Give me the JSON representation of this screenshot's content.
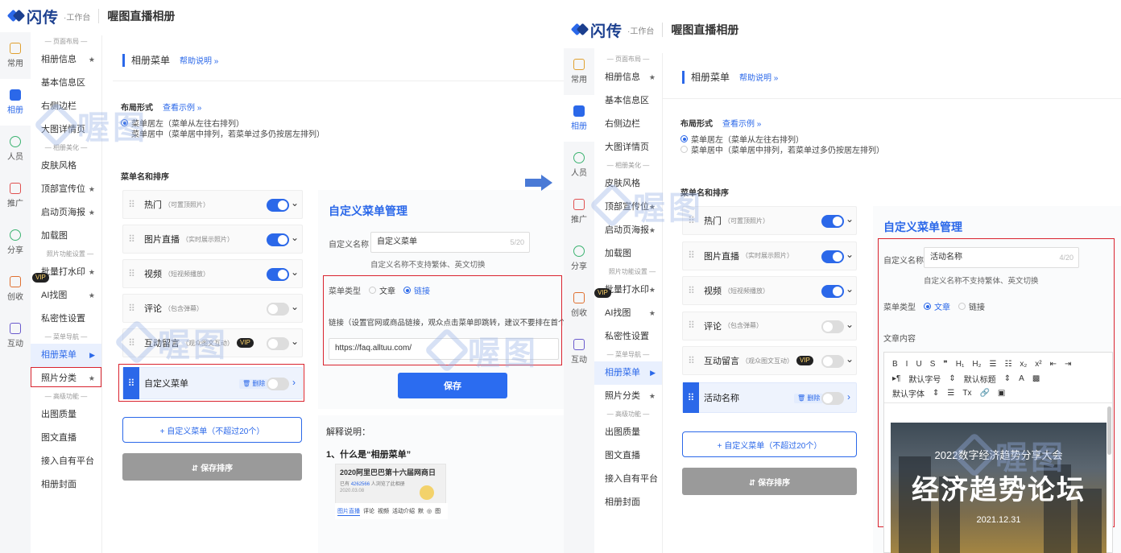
{
  "app": {
    "logo_name": "闪传",
    "logo_sub": "·工作台",
    "page_title": "喔图直播相册"
  },
  "rail": [
    {
      "label": "常用",
      "icon": "star-icon"
    },
    {
      "label": "相册",
      "icon": "album-icon"
    },
    {
      "label": "人员",
      "icon": "people-icon"
    },
    {
      "label": "推广",
      "icon": "promote-icon"
    },
    {
      "label": "分享",
      "icon": "share-icon"
    },
    {
      "label": "创收",
      "icon": "revenue-icon"
    },
    {
      "label": "互动",
      "icon": "interact-icon"
    }
  ],
  "sidebar": {
    "sec_layout": "— 页面布局 —",
    "album_info": "相册信息",
    "basic_info": "基本信息区",
    "right_bar": "右侧边栏",
    "big_detail": "大图详情页",
    "sec_beauty": "— 相册美化 —",
    "skin": "皮肤风格",
    "top_promo": "顶部宣传位",
    "splash": "启动页海报",
    "loading": "加载图",
    "sec_photo": "照片功能设置 —",
    "vip": "VIP",
    "watermark": "批量打水印",
    "ai_find": "AI找图",
    "privacy": "私密性设置",
    "sec_nav": "— 菜单导航 —",
    "album_menu": "相册菜单",
    "photo_cat": "照片分类",
    "sec_adv": "— 高级功能 —",
    "quality": "出图质量",
    "text_live": "图文直播",
    "own_platform": "接入自有平台",
    "cover": "相册封面",
    "star": "★",
    "caret": "▶"
  },
  "main": {
    "title": "相册菜单",
    "help": "帮助说明 »",
    "layout_label": "布局形式",
    "example_link": "查看示例 »",
    "layout_left": "菜单居左（菜单从左往右排列）",
    "layout_center": "菜单居中（菜单居中排列，若菜单过多仍按居左排列）",
    "sort_label": "菜单名和排序",
    "menus": [
      {
        "name": "热门",
        "sub": "（可置顶照片）"
      },
      {
        "name": "图片直播",
        "sub": "（实时展示照片）"
      },
      {
        "name": "视频",
        "sub": "（短视频播放）"
      },
      {
        "name": "评论",
        "sub": "（包含弹幕）"
      },
      {
        "name": "互动留言",
        "sub": "（观众图文互动）"
      }
    ],
    "custom_menu_left": "自定义菜单",
    "custom_menu_right": "活动名称",
    "delete": "删除",
    "add_custom": "+ 自定义菜单（不超过20个）",
    "save_sort": "⇵ 保存排序"
  },
  "custom_left": {
    "title": "自定义菜单管理",
    "name_label": "自定义名称",
    "name_value": "自定义菜单",
    "name_count": "5/20",
    "name_hint": "自定义名称不支持繁体、英文切换",
    "type_label": "菜单类型",
    "type_article": "文章",
    "type_link": "链接",
    "link_desc": "链接（设置官网或商品链接，观众点击菜单即跳转，建议不要排在首个菜单）",
    "link_value": "https://faq.alltuu.com/",
    "save": "保存"
  },
  "explain": {
    "title": "解释说明：",
    "q1": "1、什么是“相册菜单”",
    "thumb_title": "2020阿里巴巴第十六届网商日",
    "thumb_line_a": "已有",
    "thumb_count": "4262566",
    "thumb_line_b": "人浏览了此相册",
    "thumb_date": "2020.03.08",
    "thumb_tabs": [
      "图片直播",
      "评论",
      "视频",
      "活动介绍",
      "默",
      "◎",
      "图"
    ]
  },
  "custom_right": {
    "title": "自定义菜单管理",
    "name_label": "自定义名称",
    "name_value": "活动名称",
    "name_count": "4/20",
    "name_hint": "自定义名称不支持繁体、英文切换",
    "type_label": "菜单类型",
    "type_article": "文章",
    "type_link": "链接",
    "content_label": "文章内容",
    "toolbar_row1": [
      "B",
      "I",
      "U",
      "S",
      "❞",
      "H₁",
      "H₂",
      "☰",
      "☷",
      "x₂",
      "x²",
      "⇤",
      "⇥"
    ],
    "toolbar_row2": [
      "▸¶",
      "默认字号",
      "⇕",
      "默认标题",
      "⇕",
      "A",
      "▩"
    ],
    "toolbar_row3": [
      "默认字体",
      "⇕",
      "☰",
      "Tx",
      "🔗",
      "▣"
    ],
    "poster_line1": "2022数字经济趋势分享大会",
    "poster_line2": "经济趋势论坛",
    "poster_date": "2021.12.31"
  },
  "watermark": "喔图",
  "colors": {
    "accent": "#2b68e9",
    "highlight": "#d9232e"
  }
}
